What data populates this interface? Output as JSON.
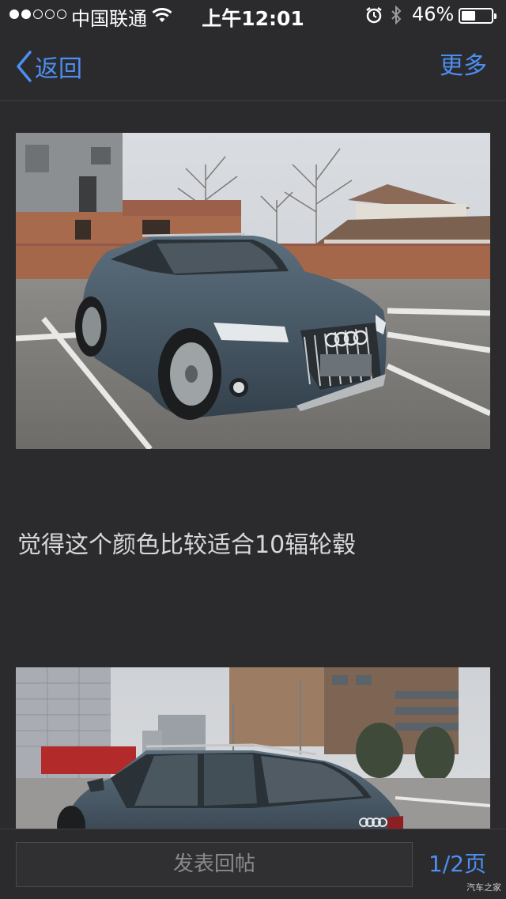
{
  "status_bar": {
    "carrier": "中国联通",
    "time": "上午12:01",
    "battery_percent_text": "46%",
    "battery_level": 0.46,
    "signal_bars_filled": 2,
    "signal_bars_total": 5
  },
  "nav": {
    "back_label": "返回",
    "more_label": "更多"
  },
  "post": {
    "text": "觉得这个颜色比较适合10辐轮毂"
  },
  "bottom_bar": {
    "reply_placeholder": "发表回帖",
    "page_indicator": "1/2页"
  },
  "watermark": "汽车之家",
  "colors": {
    "background": "#2b2b2d",
    "accent": "#4c8ff2",
    "text_secondary": "#d8d8d8"
  },
  "icons": {
    "back": "chevron-left-icon",
    "wifi": "wifi-icon",
    "alarm": "alarm-clock-icon",
    "bluetooth": "bluetooth-icon",
    "battery": "battery-icon"
  }
}
